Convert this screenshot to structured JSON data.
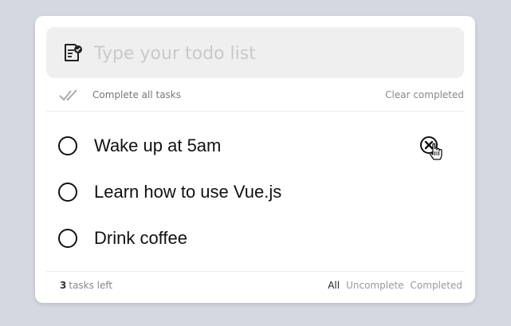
{
  "input": {
    "placeholder": "Type your todo list",
    "value": ""
  },
  "toolbar": {
    "complete_all_label": "Complete all tasks",
    "clear_completed_label": "Clear completed"
  },
  "todos": [
    {
      "text": "Wake up at 5am",
      "completed": false,
      "hovered": true
    },
    {
      "text": "Learn how to use Vue.js",
      "completed": false,
      "hovered": false
    },
    {
      "text": "Drink coffee",
      "completed": false,
      "hovered": false
    }
  ],
  "footer": {
    "count": "3",
    "count_suffix": "tasks left",
    "filters": [
      "All",
      "Uncomplete",
      "Completed"
    ],
    "active_filter": "All"
  },
  "colors": {
    "background": "#d5d8e0",
    "card": "#ffffff",
    "input_bg": "#efefef",
    "text": "#111111",
    "muted": "#888888"
  },
  "icons": {
    "input": "note-check-icon",
    "complete_all": "double-check-icon",
    "delete": "close-circle-icon",
    "cursor": "hand-pointer-icon"
  }
}
